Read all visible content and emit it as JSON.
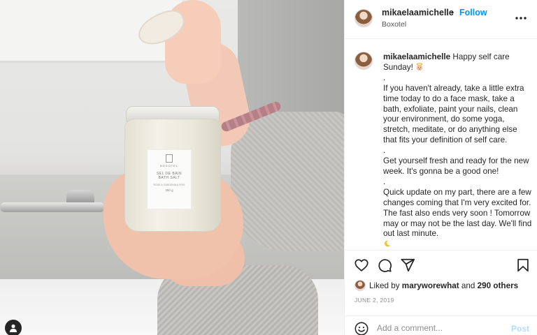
{
  "post": {
    "username": "mikaelaamichelle",
    "follow_label": "Follow",
    "separator": "•",
    "location": "Boxotel",
    "caption": {
      "username": "mikaelaamichelle",
      "line_greeting": "Happy self care Sunday!",
      "dot1": ".",
      "paragraph1": "If you haven't already, take a little extra time today to do a face mask, take a bath, exfoliate, paint your nails, clean your environment, do some yoga, stretch, meditate, or do anything else that fits your definition of self care.",
      "dot2": ".",
      "paragraph2": "Get yourself fresh and ready for the new week. It's gonna be a good one!",
      "dot3": ".",
      "paragraph3": "Quick update on my part, there are a few changes coming that I'm very excited for. The fast also ends very soon ! Tomorrow may or may not be the last day. We'll find out last minute."
    },
    "likes": {
      "prefix": "Liked by",
      "user": "maryworewhat",
      "connector": "and",
      "others": "290 others"
    },
    "date": "JUNE 2, 2019"
  },
  "comment": {
    "placeholder": "Add a comment...",
    "post_label": "Post"
  },
  "product": {
    "brand": "BOXOTEL",
    "line1": "SEL DE BAIN",
    "line2": "BATH SALT",
    "line3": "ROSE & GARDENIA & POIS",
    "line4": "350 g"
  },
  "icons": {
    "more": "more-options-icon",
    "like": "heart-icon",
    "comment": "comment-icon",
    "share": "share-icon",
    "save": "bookmark-icon",
    "emoji": "smiley-icon",
    "tag": "user-tag-icon"
  },
  "colors": {
    "accent": "#0095f6",
    "post_disabled": "#b3dbff",
    "text": "#262626",
    "muted": "#8e8e8e",
    "border": "#efefef"
  }
}
